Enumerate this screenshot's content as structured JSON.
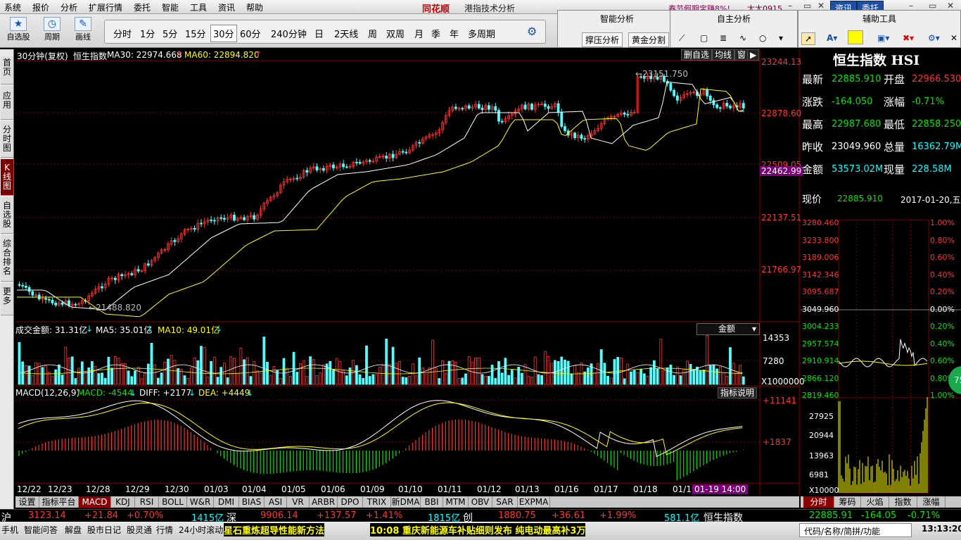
{
  "menu": {
    "items": [
      "系统",
      "报价",
      "分析",
      "扩展行情",
      "委托",
      "智能",
      "工具",
      "资讯",
      "帮助"
    ],
    "brand": "同花顺",
    "title": "港指技术分析",
    "promo": "春节假期宝赚8%!",
    "user": "太太0915",
    "btn_zixun": "资讯",
    "btn_weituo": "委托"
  },
  "toolbar": {
    "tools": [
      {
        "label": "自选股",
        "icon": "star-icon"
      },
      {
        "label": "周期",
        "icon": "clock-icon"
      },
      {
        "label": "画线",
        "icon": "pencil-icon"
      }
    ],
    "periods": [
      "分时",
      "1分",
      "5分",
      "15分",
      "30分",
      "60分",
      "240分钟",
      "日",
      "2天线",
      "周",
      "双周",
      "月",
      "季",
      "年",
      "多周期"
    ],
    "selected_period": "30分",
    "smart_panel": {
      "title": "智能分析",
      "b1": "撑压分析",
      "b2": "黄金分割"
    },
    "self_panel": {
      "title": "自主分析"
    },
    "aux_panel": {
      "title": "辅助工具"
    }
  },
  "sidetabs": [
    "首页",
    "应用",
    "分时图",
    "K线图",
    "自选股",
    "综合排名",
    "更多"
  ],
  "chart_header": {
    "label": "30分钟(复权)",
    "name": "恒生指数",
    "ma30_label": "MA30: 22974.668",
    "ma60_label": "MA60: 22894.820",
    "btn_del": "删自选",
    "btn_ma": "均线",
    "btn_win": "窗"
  },
  "price_axis": [
    "23244.13",
    "22878.60",
    "22509.05",
    "22462.99",
    "22137.51",
    "21766.97"
  ],
  "price_annotations": {
    "high": "23151.750",
    "low": "21488.820"
  },
  "volume_header": {
    "label": "成交金额: 31.31亿",
    "ma5": "MA5: 35.01亿",
    "ma10": "MA10: 49.01亿",
    "dropdown": "金额"
  },
  "volume_axis": [
    "14353",
    "7280",
    "X1000000"
  ],
  "macd_header": {
    "label": "MACD(12,26,9)",
    "macd": "MACD: -4544",
    "diff": "DIFF: +2177",
    "dea": "DEA: +4449",
    "btn": "指标说明"
  },
  "macd_axis": [
    "+11141",
    "+1837"
  ],
  "date_axis": [
    "12/22",
    "12/23",
    "12/28",
    "12/29",
    "12/30",
    "01/03",
    "01/04",
    "01/05",
    "01/06",
    "01/09",
    "01/10",
    "01/11",
    "01/12",
    "01/13",
    "01/16",
    "01/17",
    "01/18",
    "01/19"
  ],
  "cursor_time": "01-19 14:00",
  "bottom_tabs": [
    "设置",
    "指标平台",
    "MACD",
    "KDJ",
    "RSI",
    "BOLL",
    "W&R",
    "DMI",
    "BIAS",
    "ASI",
    "VR",
    "ARBR",
    "DPO",
    "TRIX",
    "新DMA",
    "BBI",
    "MTM",
    "OBV",
    "SAR",
    "EXPMA"
  ],
  "bottom_selected": "MACD",
  "quote": {
    "title": "恒生指数 HSI",
    "rows": [
      {
        "l1": "最新",
        "v1": "22885.910",
        "l2": "开盘",
        "v2": "22966.530",
        "c1": "grn",
        "c2": "red"
      },
      {
        "l1": "涨跌",
        "v1": "-164.050",
        "l2": "涨幅",
        "v2": "-0.71%",
        "c1": "grn",
        "c2": "grn"
      },
      {
        "l1": "最高",
        "v1": "22987.680",
        "l2": "最低",
        "v2": "22858.250",
        "c1": "grn",
        "c2": "grn"
      },
      {
        "l1": "昨收",
        "v1": "23049.960",
        "l2": "总量",
        "v2": "16362.79M",
        "c1": "wht",
        "c2": "cyan"
      },
      {
        "l1": "金额",
        "v1": "53573.02M",
        "l2": "现量",
        "v2": "228.58M",
        "c1": "cyan",
        "c2": "cyan"
      }
    ],
    "now_label": "现价",
    "now_value": "22885.910",
    "date": "2017-01-20,五"
  },
  "mini_axis_left": [
    "3280.460",
    "3233.800",
    "3189.006",
    "3142.346",
    "3095.687",
    "3049.960",
    "3004.233",
    "2957.574",
    "2910.914",
    "2866.120",
    "2819.460"
  ],
  "mini_axis_right": [
    "1.00%",
    "0.80%",
    "0.60%",
    "0.40%",
    "0.20%",
    "0.00%",
    "0.20%",
    "0.40%",
    "0.60%",
    "0.80%",
    "1.00%"
  ],
  "mini_vol_axis": [
    "27925",
    "20944",
    "13963",
    "6981",
    "X10000"
  ],
  "mini_badge": "75",
  "right_tabs": [
    "分时",
    "筹码",
    "火焰",
    "指数",
    "涨幅"
  ],
  "right_selected": "分时",
  "ticker": {
    "sh": "沪",
    "sh_v": "3123.14",
    "sh_c": "+21.84",
    "sh_p": "+0.70%",
    "sh_amt": "1415亿",
    "sz": "深",
    "sz_v": "9906.14",
    "sz_c": "+137.57",
    "sz_p": "+1.41%",
    "sz_amt": "1815亿",
    "cy": "创",
    "cy_v": "1880.75",
    "cy_c": "+36.61",
    "cy_p": "+1.99%",
    "cy_amt": "581.1亿",
    "hs": "恒生指数",
    "hs_v": "22885.91",
    "hs_c": "-164.05",
    "hs_p": "-0.71%"
  },
  "status": {
    "items": [
      "手机",
      "智能问答",
      "解盘",
      "股市日记",
      "股灵通",
      "行情",
      "24小时滚动"
    ],
    "news1": "星石重炼超导性能新方法",
    "news2": "10:08 重庆新能源车补贴细则发布 纯电动最高补3万",
    "search": "代码/名称/简拼/功能",
    "time": "13:13:20"
  }
}
